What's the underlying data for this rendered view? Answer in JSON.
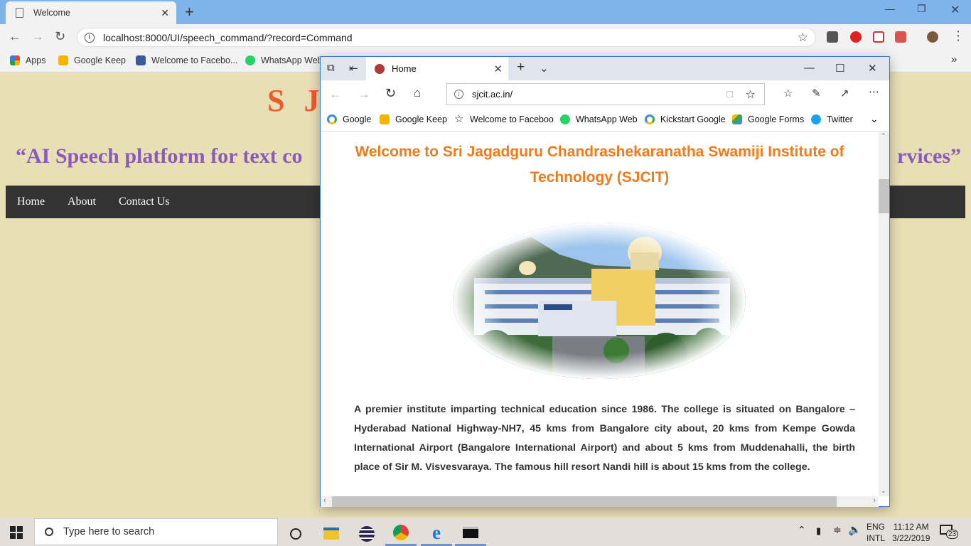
{
  "chrome": {
    "tab_title": "Welcome",
    "url": "localhost:8000/UI/speech_command/?record=Command",
    "bookmarks": [
      {
        "label": "Apps",
        "icon": "apps-grid-icon",
        "color": "#e0453a"
      },
      {
        "label": "Google Keep",
        "icon": "google-keep-icon",
        "color": "#f6b400"
      },
      {
        "label": "Welcome to Facebo...",
        "icon": "facebook-icon",
        "color": "#3b5998"
      },
      {
        "label": "WhatsApp Web",
        "icon": "whatsapp-icon",
        "color": "#25d366"
      }
    ],
    "overflow": "»"
  },
  "page": {
    "title": "S J",
    "tagline_left": "“AI Speech platform for text co",
    "tagline_right": "rvices”",
    "nav": [
      "Home",
      "About",
      "Contact Us"
    ],
    "colors": {
      "background": "#e8dfb5",
      "title": "#f05a2a",
      "tagline": "#8a5cb8",
      "nav": "#333333"
    }
  },
  "edge": {
    "tab_title": "Home",
    "url": "sjcit.ac.in/",
    "favorites": [
      {
        "label": "Google",
        "icon": "google-icon"
      },
      {
        "label": "Google Keep",
        "icon": "google-keep-icon"
      },
      {
        "label": "Welcome to Faceboo",
        "icon": "star-outline-icon"
      },
      {
        "label": "WhatsApp Web",
        "icon": "whatsapp-icon"
      },
      {
        "label": "Kickstart Google",
        "icon": "google-icon"
      },
      {
        "label": "Google Forms",
        "icon": "google-drive-icon"
      },
      {
        "label": "Twitter",
        "icon": "twitter-icon"
      }
    ],
    "content": {
      "heading": "Welcome to Sri Jagadguru Chandrashekaranatha Swamiji Institute of Technology (SJCIT)",
      "paragraph": "A premier institute imparting technical education since 1986. The college is situated on Bangalore – Hyderabad National Highway-NH7, 45 kms from Bangalore city about, 20 kms from Kempe Gowda International Airport (Bangalore International Airport) and about 5 kms from Muddenahalli, the birth place of Sir M. Visvesvaraya. The famous hill resort Nandi hill is about 15 kms from the college."
    }
  },
  "taskbar": {
    "search_placeholder": "Type here to search",
    "lang_1": "ENG",
    "lang_2": "INTL",
    "time": "11:12 AM",
    "date": "3/22/2019",
    "notifications": "23"
  }
}
